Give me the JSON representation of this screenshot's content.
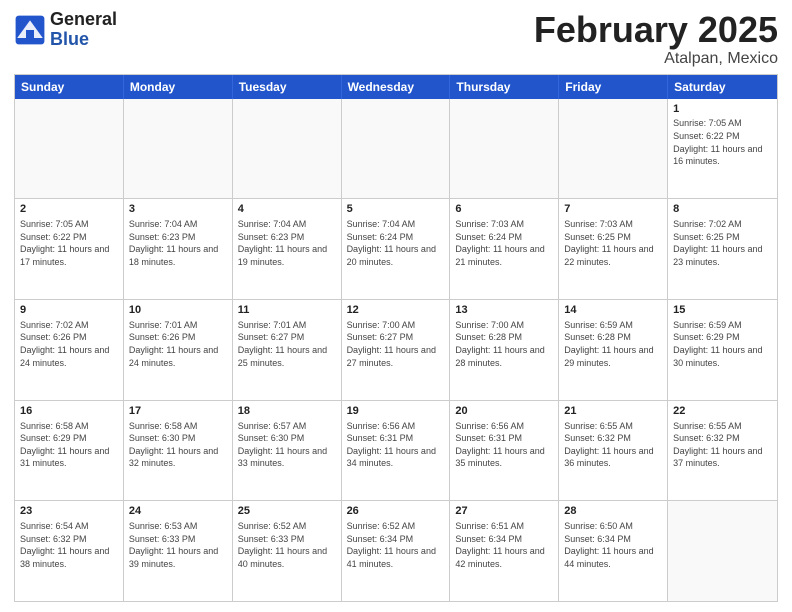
{
  "header": {
    "logo_general": "General",
    "logo_blue": "Blue",
    "title": "February 2025",
    "subtitle": "Atalpan, Mexico"
  },
  "weekdays": [
    "Sunday",
    "Monday",
    "Tuesday",
    "Wednesday",
    "Thursday",
    "Friday",
    "Saturday"
  ],
  "rows": [
    [
      {
        "day": "",
        "info": ""
      },
      {
        "day": "",
        "info": ""
      },
      {
        "day": "",
        "info": ""
      },
      {
        "day": "",
        "info": ""
      },
      {
        "day": "",
        "info": ""
      },
      {
        "day": "",
        "info": ""
      },
      {
        "day": "1",
        "info": "Sunrise: 7:05 AM\nSunset: 6:22 PM\nDaylight: 11 hours and 16 minutes."
      }
    ],
    [
      {
        "day": "2",
        "info": "Sunrise: 7:05 AM\nSunset: 6:22 PM\nDaylight: 11 hours and 17 minutes."
      },
      {
        "day": "3",
        "info": "Sunrise: 7:04 AM\nSunset: 6:23 PM\nDaylight: 11 hours and 18 minutes."
      },
      {
        "day": "4",
        "info": "Sunrise: 7:04 AM\nSunset: 6:23 PM\nDaylight: 11 hours and 19 minutes."
      },
      {
        "day": "5",
        "info": "Sunrise: 7:04 AM\nSunset: 6:24 PM\nDaylight: 11 hours and 20 minutes."
      },
      {
        "day": "6",
        "info": "Sunrise: 7:03 AM\nSunset: 6:24 PM\nDaylight: 11 hours and 21 minutes."
      },
      {
        "day": "7",
        "info": "Sunrise: 7:03 AM\nSunset: 6:25 PM\nDaylight: 11 hours and 22 minutes."
      },
      {
        "day": "8",
        "info": "Sunrise: 7:02 AM\nSunset: 6:25 PM\nDaylight: 11 hours and 23 minutes."
      }
    ],
    [
      {
        "day": "9",
        "info": "Sunrise: 7:02 AM\nSunset: 6:26 PM\nDaylight: 11 hours and 24 minutes."
      },
      {
        "day": "10",
        "info": "Sunrise: 7:01 AM\nSunset: 6:26 PM\nDaylight: 11 hours and 24 minutes."
      },
      {
        "day": "11",
        "info": "Sunrise: 7:01 AM\nSunset: 6:27 PM\nDaylight: 11 hours and 25 minutes."
      },
      {
        "day": "12",
        "info": "Sunrise: 7:00 AM\nSunset: 6:27 PM\nDaylight: 11 hours and 27 minutes."
      },
      {
        "day": "13",
        "info": "Sunrise: 7:00 AM\nSunset: 6:28 PM\nDaylight: 11 hours and 28 minutes."
      },
      {
        "day": "14",
        "info": "Sunrise: 6:59 AM\nSunset: 6:28 PM\nDaylight: 11 hours and 29 minutes."
      },
      {
        "day": "15",
        "info": "Sunrise: 6:59 AM\nSunset: 6:29 PM\nDaylight: 11 hours and 30 minutes."
      }
    ],
    [
      {
        "day": "16",
        "info": "Sunrise: 6:58 AM\nSunset: 6:29 PM\nDaylight: 11 hours and 31 minutes."
      },
      {
        "day": "17",
        "info": "Sunrise: 6:58 AM\nSunset: 6:30 PM\nDaylight: 11 hours and 32 minutes."
      },
      {
        "day": "18",
        "info": "Sunrise: 6:57 AM\nSunset: 6:30 PM\nDaylight: 11 hours and 33 minutes."
      },
      {
        "day": "19",
        "info": "Sunrise: 6:56 AM\nSunset: 6:31 PM\nDaylight: 11 hours and 34 minutes."
      },
      {
        "day": "20",
        "info": "Sunrise: 6:56 AM\nSunset: 6:31 PM\nDaylight: 11 hours and 35 minutes."
      },
      {
        "day": "21",
        "info": "Sunrise: 6:55 AM\nSunset: 6:32 PM\nDaylight: 11 hours and 36 minutes."
      },
      {
        "day": "22",
        "info": "Sunrise: 6:55 AM\nSunset: 6:32 PM\nDaylight: 11 hours and 37 minutes."
      }
    ],
    [
      {
        "day": "23",
        "info": "Sunrise: 6:54 AM\nSunset: 6:32 PM\nDaylight: 11 hours and 38 minutes."
      },
      {
        "day": "24",
        "info": "Sunrise: 6:53 AM\nSunset: 6:33 PM\nDaylight: 11 hours and 39 minutes."
      },
      {
        "day": "25",
        "info": "Sunrise: 6:52 AM\nSunset: 6:33 PM\nDaylight: 11 hours and 40 minutes."
      },
      {
        "day": "26",
        "info": "Sunrise: 6:52 AM\nSunset: 6:34 PM\nDaylight: 11 hours and 41 minutes."
      },
      {
        "day": "27",
        "info": "Sunrise: 6:51 AM\nSunset: 6:34 PM\nDaylight: 11 hours and 42 minutes."
      },
      {
        "day": "28",
        "info": "Sunrise: 6:50 AM\nSunset: 6:34 PM\nDaylight: 11 hours and 44 minutes."
      },
      {
        "day": "",
        "info": ""
      }
    ]
  ]
}
